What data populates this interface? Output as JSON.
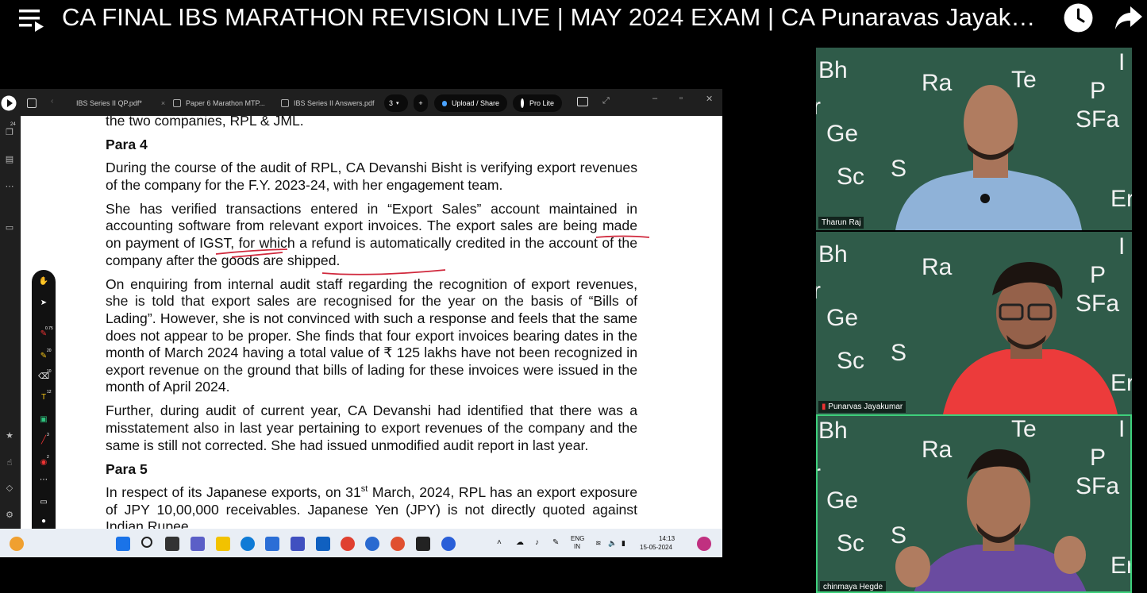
{
  "video_title": "CA FINAL IBS MARATHON REVISION LIVE | MAY 2024 EXAM | CA Punaravas Jayaku…",
  "tabs": [
    {
      "label": "IBS Series II QP.pdf*"
    },
    {
      "label": "Paper 6 Marathon MTP..."
    },
    {
      "label": "IBS Series II Answers.pdf"
    }
  ],
  "tab_count": "3",
  "upload_label": "Upload / Share",
  "pro_label": "Pro Lite",
  "rail_badge": "24",
  "document": {
    "intro_line": "the two companies, RPL & JML.",
    "para4_heading": "Para 4",
    "para4_p1": "During the course of the audit of RPL, CA Devanshi Bisht is verifying export revenues of the company for the F.Y. 2023-24, with her engagement team.",
    "para4_p2": "She has verified transactions entered in “Export Sales” account maintained in accounting software from relevant export invoices. The export sales are being made on payment of IGST, for which a refund is automatically credited in the account of the company after the goods are shipped.",
    "para4_p3": "On enquiring from internal audit staff regarding the recognition of export revenues, she is told that export sales are recognised for the year on the basis of “Bills of Lading”. However, she is not convinced with such a response and feels that the same does not appear to be proper. She finds that four export invoices bearing dates in the month of March 2024 having a total value of ₹ 125 lakhs have not been recognized in export revenue on the ground that bills of lading for these invoices were issued in the month of April 2024.",
    "para4_p4": "Further, during audit of current year, CA Devanshi had identified that there was a misstatement also in last year pertaining to export revenues of the company and the same is still not corrected. She had issued unmodified audit report in last year.",
    "para5_heading": "Para 5",
    "para5_p1a": "In respect of its Japanese exports, on 31",
    "para5_p1sup": "st",
    "para5_p1b": " March, 2024, RPL has an export exposure of JPY 10,00,000 receivables. Japanese Yen (JPY) is not directly quoted against Indian Rupee."
  },
  "pen_badges": [
    "0.75",
    "20",
    "10",
    "12",
    "3",
    "2"
  ],
  "taskbar": {
    "lang_top": "ENG",
    "lang_bottom": "IN",
    "time": "14:13",
    "date": "15-05-2024"
  },
  "participants": [
    {
      "name": "Tharun Raj"
    },
    {
      "name": "Punarvas Jayakumar"
    },
    {
      "name": "chinmaya Hegde"
    }
  ],
  "board_words": [
    "Bh",
    "Ra",
    "Te",
    "I",
    "P",
    "r",
    "Ge",
    "SFa",
    "Sc",
    "S",
    "Er"
  ]
}
